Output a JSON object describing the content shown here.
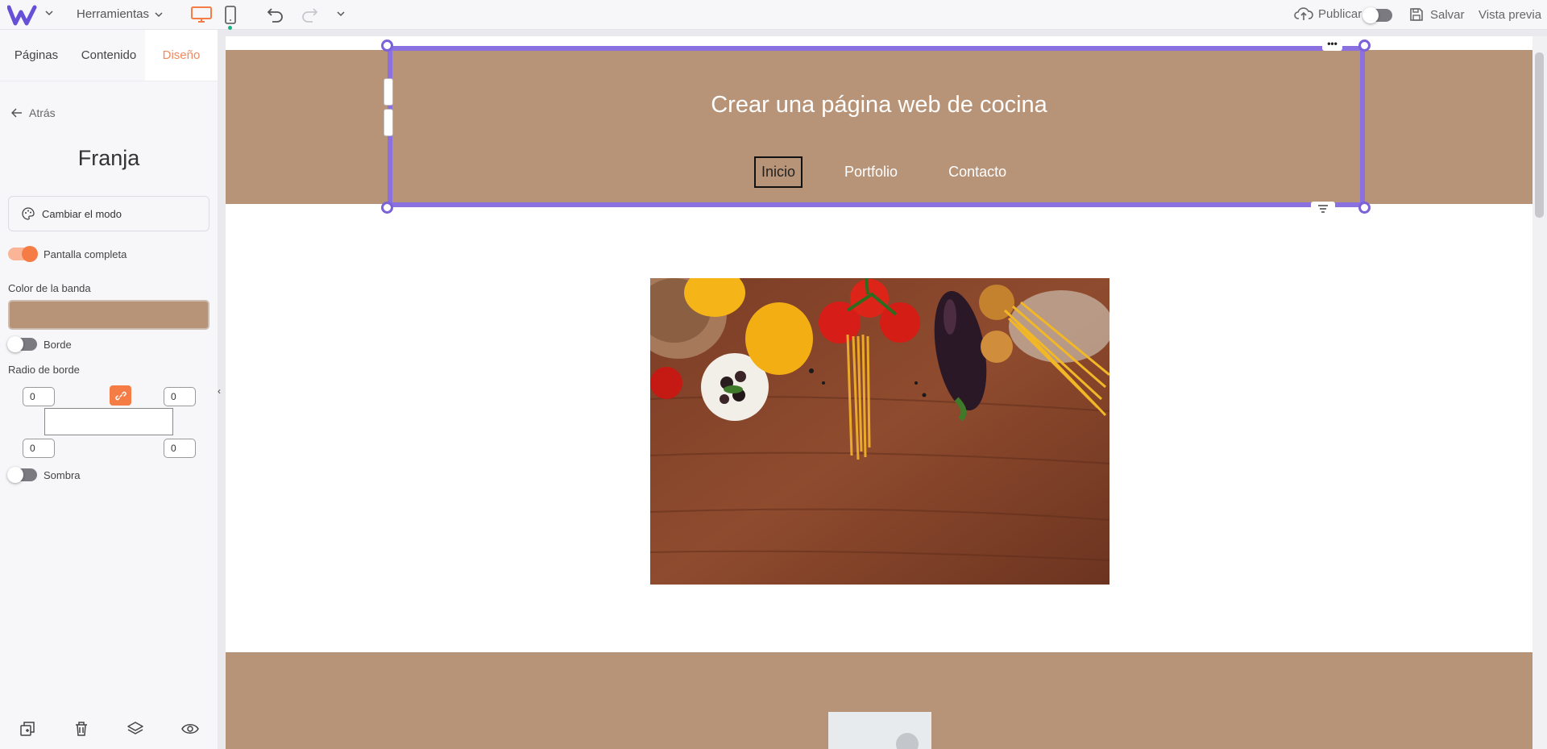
{
  "colors": {
    "accent": "#f57d45",
    "band": "#b79378",
    "selection": "#8b70e0",
    "brand": "#6650d7"
  },
  "topbar": {
    "tools_label": "Herramientas",
    "publish_label": "Publicar",
    "save_label": "Salvar",
    "preview_label": "Vista previa"
  },
  "panel": {
    "tabs": [
      {
        "label": "Páginas"
      },
      {
        "label": "Contenido"
      },
      {
        "label": "Diseño"
      }
    ],
    "back_label": "Atrás",
    "title": "Franja",
    "mode_button": "Cambiar el modo",
    "fullscreen_label": "Pantalla completa",
    "band_color_label": "Color de la banda",
    "border_label": "Borde",
    "radius_label": "Radio de borde",
    "radius": {
      "top_left": "0",
      "top_right": "0",
      "bottom_left": "0",
      "bottom_right": "0"
    },
    "shadow_label": "Sombra"
  },
  "site": {
    "title": "Crear una página web de cocina",
    "nav": [
      {
        "label": "Inicio"
      },
      {
        "label": "Portfolio"
      },
      {
        "label": "Contacto"
      }
    ]
  }
}
